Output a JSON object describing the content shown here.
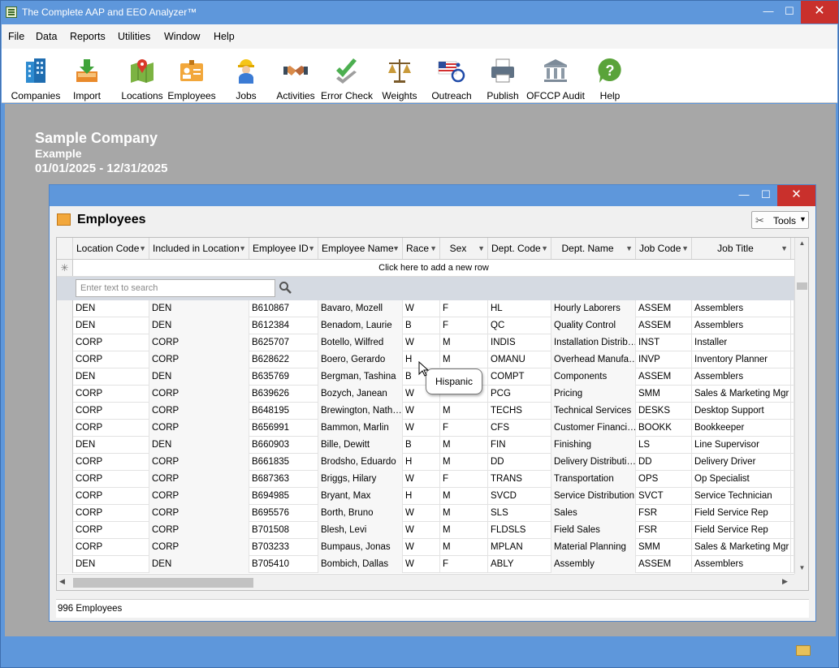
{
  "app": {
    "title": "The Complete AAP and EEO Analyzer™",
    "window_controls": {
      "minimize": "—",
      "maximize": "☐",
      "close": "✕"
    }
  },
  "menu": [
    "File",
    "Data",
    "Reports",
    "Utilities",
    "Window",
    "Help"
  ],
  "toolbar": [
    {
      "label": "Companies",
      "icon": "companies-icon"
    },
    {
      "label": "Import",
      "icon": "import-icon"
    },
    {
      "label": "Locations",
      "icon": "locations-icon"
    },
    {
      "label": "Employees",
      "icon": "employees-icon"
    },
    {
      "label": "Jobs",
      "icon": "jobs-icon"
    },
    {
      "label": "Activities",
      "icon": "activities-icon"
    },
    {
      "label": "Error Check",
      "icon": "error-check-icon"
    },
    {
      "label": "Weights",
      "icon": "weights-icon"
    },
    {
      "label": "Outreach",
      "icon": "outreach-icon"
    },
    {
      "label": "Publish",
      "icon": "publish-icon"
    },
    {
      "label": "OFCCP Audit",
      "icon": "ofccp-audit-icon"
    },
    {
      "label": "Help",
      "icon": "help-icon"
    }
  ],
  "company": {
    "name": "Sample Company",
    "subtitle": "Example",
    "dates": "01/01/2025 - 12/31/2025"
  },
  "employees_window": {
    "title": "Employees",
    "tools_label": "Tools",
    "add_row_text": "Click here to add a new row",
    "search_placeholder": "Enter text to search",
    "status": "996 Employees",
    "tooltip": "Hispanic",
    "columns": [
      "Location Code",
      "Included in Location",
      "Employee ID",
      "Employee Name",
      "Race",
      "Sex",
      "Dept. Code",
      "Dept. Name",
      "Job Code",
      "Job Title"
    ],
    "rows": [
      [
        "DEN",
        "DEN",
        "B610867",
        "Bavaro, Mozell",
        "W",
        "F",
        "HL",
        "Hourly Laborers",
        "ASSEM",
        "Assemblers"
      ],
      [
        "DEN",
        "DEN",
        "B612384",
        "Benadom, Laurie",
        "B",
        "F",
        "QC",
        "Quality Control",
        "ASSEM",
        "Assemblers"
      ],
      [
        "CORP",
        "CORP",
        "B625707",
        "Botello, Wilfred",
        "W",
        "M",
        "INDIS",
        "Installation Distrib…",
        "INST",
        "Installer"
      ],
      [
        "CORP",
        "CORP",
        "B628622",
        "Boero, Gerardo",
        "H",
        "M",
        "OMANU",
        "Overhead Manufa…",
        "INVP",
        "Inventory Planner"
      ],
      [
        "DEN",
        "DEN",
        "B635769",
        "Bergman, Tashina",
        "B",
        "",
        "COMPT",
        "Components",
        "ASSEM",
        "Assemblers"
      ],
      [
        "CORP",
        "CORP",
        "B639626",
        "Bozych, Janean",
        "W",
        "",
        "PCG",
        "Pricing",
        "SMM",
        "Sales & Marketing Mgr"
      ],
      [
        "CORP",
        "CORP",
        "B648195",
        "Brewington, Nath…",
        "W",
        "M",
        "TECHS",
        "Technical Services",
        "DESKS",
        "Desktop Support"
      ],
      [
        "CORP",
        "CORP",
        "B656991",
        "Bammon, Marlin",
        "W",
        "F",
        "CFS",
        "Customer Financi…",
        "BOOKK",
        "Bookkeeper"
      ],
      [
        "DEN",
        "DEN",
        "B660903",
        "Bille, Dewitt",
        "B",
        "M",
        "FIN",
        "Finishing",
        "LS",
        "Line Supervisor"
      ],
      [
        "CORP",
        "CORP",
        "B661835",
        "Brodsho, Eduardo",
        "H",
        "M",
        "DD",
        "Delivery Distributi…",
        "DD",
        "Delivery Driver"
      ],
      [
        "CORP",
        "CORP",
        "B687363",
        "Briggs, Hilary",
        "W",
        "F",
        "TRANS",
        "Transportation",
        "OPS",
        "Op Specialist"
      ],
      [
        "CORP",
        "CORP",
        "B694985",
        "Bryant, Max",
        "H",
        "M",
        "SVCD",
        "Service Distribution",
        "SVCT",
        "Service Technician"
      ],
      [
        "CORP",
        "CORP",
        "B695576",
        "Borth, Bruno",
        "W",
        "M",
        "SLS",
        "Sales",
        "FSR",
        "Field Service Rep"
      ],
      [
        "CORP",
        "CORP",
        "B701508",
        "Blesh, Levi",
        "W",
        "M",
        "FLDSLS",
        "Field Sales",
        "FSR",
        "Field Service Rep"
      ],
      [
        "CORP",
        "CORP",
        "B703233",
        "Bumpaus, Jonas",
        "W",
        "M",
        "MPLAN",
        "Material Planning",
        "SMM",
        "Sales & Marketing Mgr"
      ],
      [
        "DEN",
        "DEN",
        "B705410",
        "Bombich, Dallas",
        "W",
        "F",
        "ABLY",
        "Assembly",
        "ASSEM",
        "Assemblers"
      ]
    ]
  }
}
